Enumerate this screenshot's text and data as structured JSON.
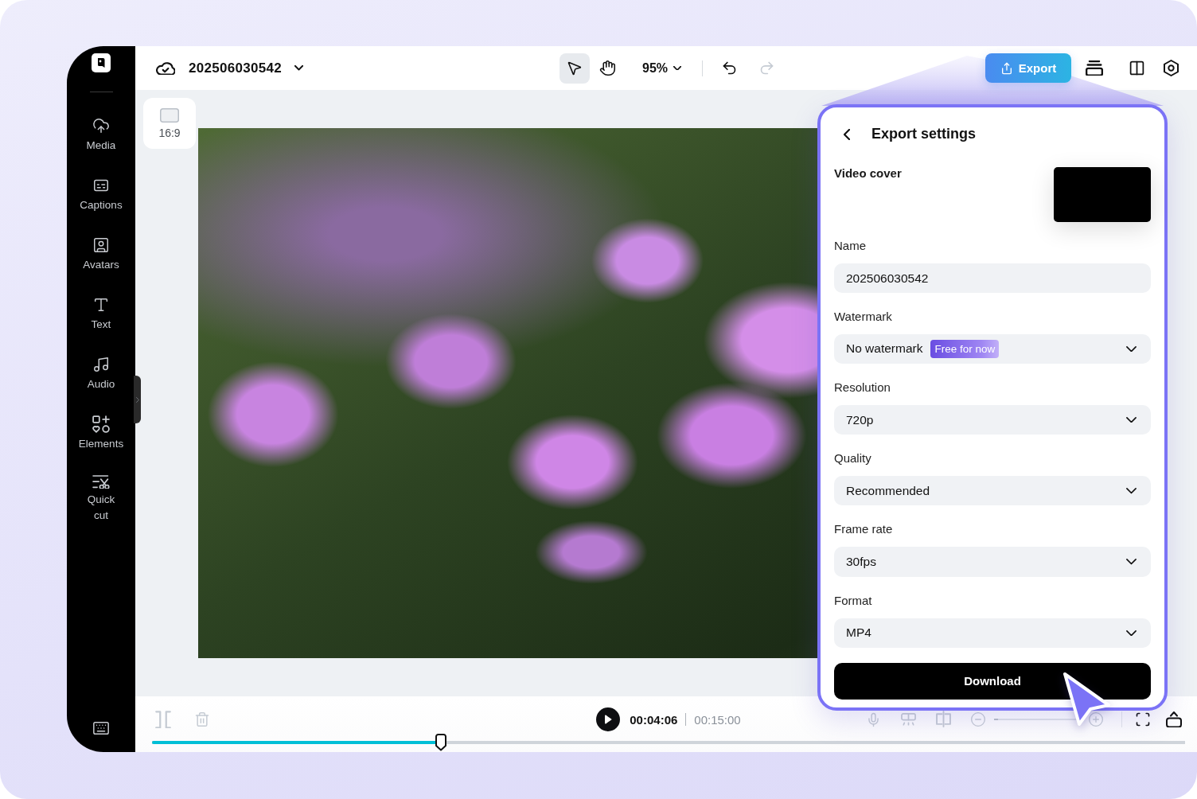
{
  "sidebar": {
    "items": [
      {
        "label": "Media"
      },
      {
        "label": "Captions"
      },
      {
        "label": "Avatars"
      },
      {
        "label": "Text"
      },
      {
        "label": "Audio"
      },
      {
        "label": "Elements"
      },
      {
        "label": "Quick cut"
      }
    ]
  },
  "topbar": {
    "project_name": "202506030542",
    "tools": [
      {
        "selected": true
      },
      {
        "selected": false
      }
    ],
    "zoom": "95%",
    "history": [
      {
        "disabled": false
      },
      {
        "disabled": true
      }
    ],
    "export_button": "Export"
  },
  "canvas": {
    "aspect_ratio": "16:9"
  },
  "export_settings": {
    "title": "Export settings",
    "video_cover_label": "Video cover",
    "fields": [
      {
        "kind": "input",
        "label": "Name",
        "value": "202506030542"
      },
      {
        "kind": "select",
        "label": "Watermark",
        "value": "No watermark",
        "badge": "Free for now"
      },
      {
        "kind": "select",
        "label": "Resolution",
        "value": "720p"
      },
      {
        "kind": "select",
        "label": "Quality",
        "value": "Recommended"
      },
      {
        "kind": "select",
        "label": "Frame rate",
        "value": "30fps"
      },
      {
        "kind": "select",
        "label": "Format",
        "value": "MP4"
      }
    ],
    "download_button": "Download"
  },
  "playback": {
    "edit_tools": [
      {
        "disabled": true
      },
      {
        "disabled": true
      }
    ],
    "current_time": "00:04:06",
    "total_time": "00:15:00",
    "audio_tools": [
      {
        "disabled": true
      },
      {
        "disabled": true
      },
      {
        "disabled": true
      }
    ],
    "zoom": {
      "disabled": true,
      "level": 0.05
    },
    "view_tools": [
      {
        "disabled": false
      },
      {
        "disabled": false
      }
    ],
    "progress": {
      "level": 0.28
    }
  }
}
